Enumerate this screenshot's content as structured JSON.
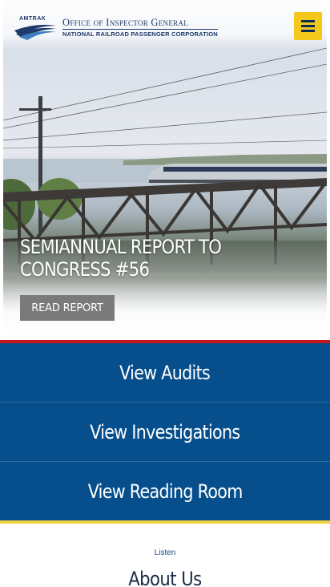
{
  "header": {
    "brand": "AMTRAK",
    "title_line1": "Office of Inspector General",
    "title_line2": "NATIONAL RAILROAD PASSENGER CORPORATION",
    "menu_icon": "hamburger-icon"
  },
  "hero": {
    "title": "SEMIANNUAL REPORT TO CONGRESS #56",
    "button_label": "READ REPORT"
  },
  "nav": {
    "items": [
      {
        "label": "View Audits"
      },
      {
        "label": "View Investigations"
      },
      {
        "label": "View Reading Room"
      }
    ]
  },
  "footer": {
    "listen_label": "Listen",
    "about_title": "About Us"
  },
  "colors": {
    "nav_blue": "#064f8c",
    "accent_red": "#c4161c",
    "accent_yellow": "#f2c91a",
    "button_gray": "#7a7a7a"
  }
}
